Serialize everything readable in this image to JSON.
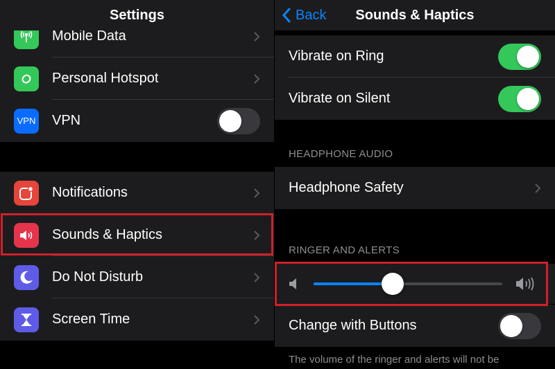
{
  "left": {
    "nav_title": "Settings",
    "items_top": [
      {
        "label": "Mobile Data",
        "icon": "antenna-icon",
        "color": "#34c759"
      },
      {
        "label": "Personal Hotspot",
        "icon": "link-icon",
        "color": "#34c759"
      },
      {
        "label": "VPN",
        "icon": "vpn-icon",
        "icon_text": "VPN",
        "color": "#0a6cff",
        "toggle": "off"
      }
    ],
    "items_bottom": [
      {
        "label": "Notifications",
        "icon": "notification-icon",
        "color": "#e5453a"
      },
      {
        "label": "Sounds & Haptics",
        "icon": "speaker-icon",
        "color": "#e5344b",
        "highlighted": true
      },
      {
        "label": "Do Not Disturb",
        "icon": "moon-icon",
        "color": "#5e5ce6"
      },
      {
        "label": "Screen Time",
        "icon": "hourglass-icon",
        "color": "#5e5ce6"
      }
    ]
  },
  "right": {
    "back_label": "Back",
    "nav_title": "Sounds & Haptics",
    "vibrate": [
      {
        "label": "Vibrate on Ring",
        "toggle": "on"
      },
      {
        "label": "Vibrate on Silent",
        "toggle": "on"
      }
    ],
    "headphone_header": "HEADPHONE AUDIO",
    "headphone_safety_label": "Headphone Safety",
    "ringer_header": "RINGER AND ALERTS",
    "ringer_volume": 0.42,
    "change_with_buttons_label": "Change with Buttons",
    "change_with_buttons_toggle": "off",
    "footer_text": "The volume of the ringer and alerts will not be"
  },
  "colors": {
    "accent": "#0a84ff",
    "toggle_on": "#34c759",
    "highlight": "#d0202a"
  }
}
